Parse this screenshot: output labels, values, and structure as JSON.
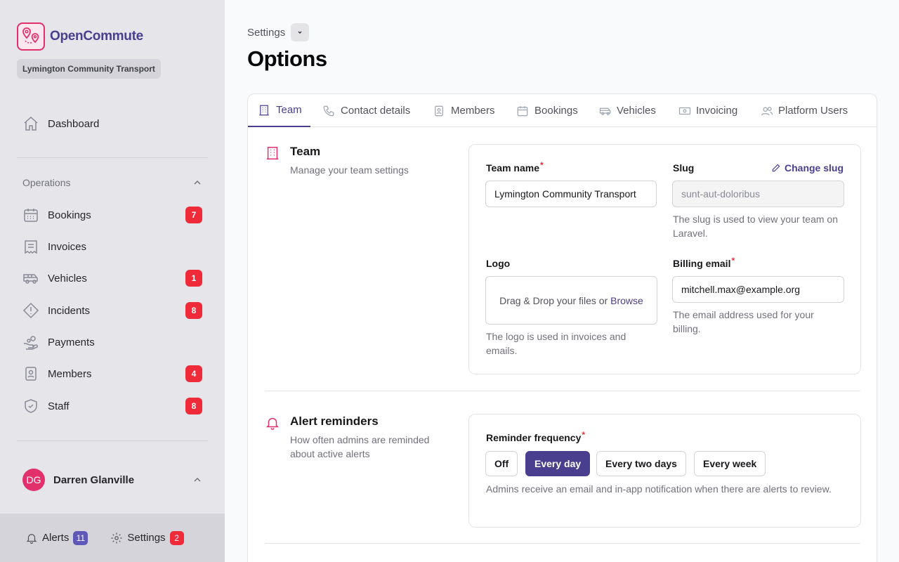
{
  "brand": {
    "name": "OpenCommute",
    "team": "Lymington Community Transport"
  },
  "nav": {
    "dashboard": "Dashboard",
    "section": "Operations",
    "items": [
      {
        "label": "Bookings",
        "badge": "7"
      },
      {
        "label": "Invoices",
        "badge": ""
      },
      {
        "label": "Vehicles",
        "badge": "1"
      },
      {
        "label": "Incidents",
        "badge": "8"
      },
      {
        "label": "Payments",
        "badge": ""
      },
      {
        "label": "Members",
        "badge": "4"
      },
      {
        "label": "Staff",
        "badge": "8"
      }
    ]
  },
  "user": {
    "initials": "DG",
    "name": "Darren Glanville"
  },
  "footer": {
    "alerts_label": "Alerts",
    "alerts_count": "11",
    "settings_label": "Settings",
    "settings_count": "2"
  },
  "header": {
    "breadcrumb": "Settings",
    "title": "Options"
  },
  "tabs": [
    "Team",
    "Contact details",
    "Members",
    "Bookings",
    "Vehicles",
    "Invoicing",
    "Platform Users"
  ],
  "team_section": {
    "title": "Team",
    "description": "Manage your team settings",
    "team_name_label": "Team name",
    "team_name_value": "Lymington Community Transport",
    "slug_label": "Slug",
    "change_slug": "Change slug",
    "slug_value": "sunt-aut-doloribus",
    "slug_help": "The slug is used to view your team on Laravel.",
    "logo_label": "Logo",
    "logo_drop_text": "Drag & Drop your files or",
    "logo_browse": "Browse",
    "logo_help": "The logo is used in invoices and emails.",
    "billing_label": "Billing email",
    "billing_value": "mitchell.max@example.org",
    "billing_help": "The email address used for your billing."
  },
  "alert_section": {
    "title": "Alert reminders",
    "description": "How often admins are reminded about active alerts",
    "freq_label": "Reminder frequency",
    "options": [
      "Off",
      "Every day",
      "Every two days",
      "Every week"
    ],
    "selected": "Every day",
    "help": "Admins receive an email and in-app notification when there are alerts to review."
  },
  "colors": {
    "accent": "#4a3f8f",
    "brand_pink": "#e1306c",
    "badge_red": "#ef2b3a"
  }
}
